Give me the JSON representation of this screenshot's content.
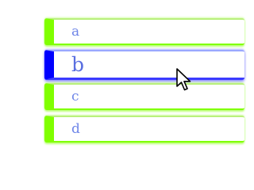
{
  "list": {
    "items": [
      {
        "label": "a",
        "selected": false
      },
      {
        "label": "b",
        "selected": true
      },
      {
        "label": "c",
        "selected": false
      },
      {
        "label": "d",
        "selected": false
      }
    ]
  },
  "colors": {
    "item_accent": "#80ff00",
    "selected_accent": "#0000ff",
    "text": "#6f86e8"
  },
  "cursor": {
    "icon": "arrow-pointer-icon"
  }
}
